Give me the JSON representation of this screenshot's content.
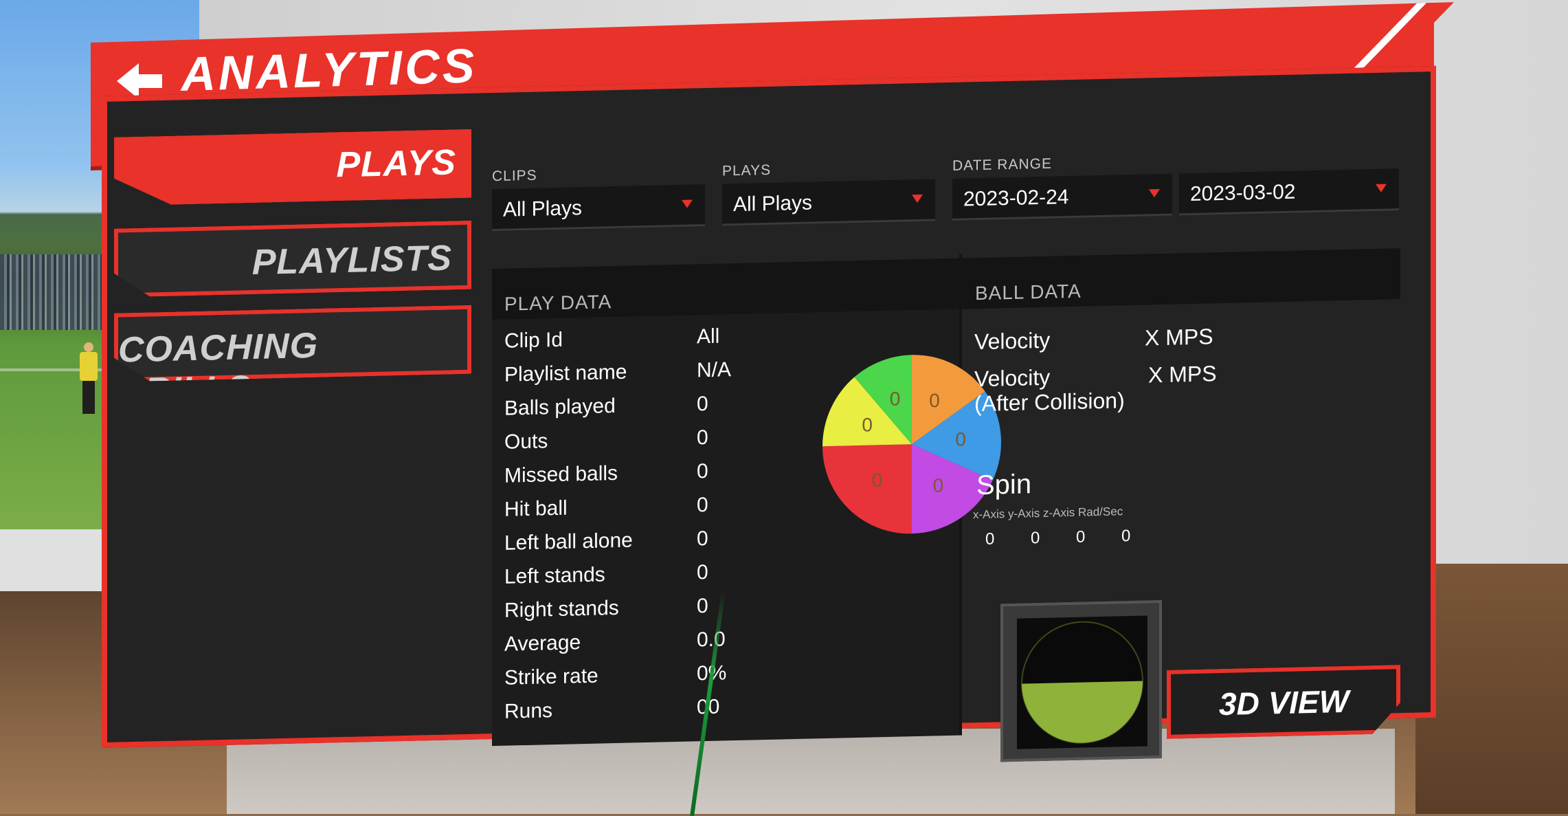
{
  "header": {
    "title": "ANALYTICS",
    "back_icon": "arrow-left-icon"
  },
  "nav": {
    "plays": "PLAYS",
    "playlists": "PLAYLISTS",
    "coaching_drills": "COACHING DRILLS"
  },
  "filters": {
    "clips_label": "CLIPS",
    "clips_value": "All Plays",
    "plays_label": "PLAYS",
    "plays_value": "All Plays",
    "date_range_label": "DATE RANGE",
    "date_from": "2023-02-24",
    "date_to": "2023-03-02"
  },
  "play_data": {
    "title": "PLAY DATA",
    "rows": [
      {
        "label": "Clip Id",
        "value": "All"
      },
      {
        "label": "Playlist name",
        "value": "N/A"
      },
      {
        "label": "Balls played",
        "value": "0"
      },
      {
        "label": "Outs",
        "value": "0"
      },
      {
        "label": "Missed balls",
        "value": "0"
      },
      {
        "label": "Hit ball",
        "value": "0"
      },
      {
        "label": "Left ball alone",
        "value": "0"
      },
      {
        "label": "Left stands",
        "value": "0"
      },
      {
        "label": "Right stands",
        "value": "0"
      },
      {
        "label": "Average",
        "value": "0.0"
      },
      {
        "label": "Strike rate",
        "value": "0%"
      },
      {
        "label": "Runs",
        "value": "00"
      }
    ],
    "pie": {
      "slices": [
        {
          "color": "#f39a3c",
          "label": "0"
        },
        {
          "color": "#3f9be6",
          "label": "0"
        },
        {
          "color": "#c24be6",
          "label": "0"
        },
        {
          "color": "#e8333b",
          "label": "0"
        },
        {
          "color": "#e9ee42",
          "label": "0"
        },
        {
          "color": "#4bd64b",
          "label": "0"
        }
      ]
    }
  },
  "ball_data": {
    "title": "BALL DATA",
    "velocity_label": "Velocity",
    "velocity_value": "X MPS",
    "velocity_after_label": "Velocity",
    "velocity_after_sub": "(After Collision)",
    "velocity_after_value": "X MPS",
    "spin_title": "Spin",
    "spin_axes": "x-Axis y-Axis z-Axis Rad/Sec",
    "spin_values": [
      "0",
      "0",
      "0",
      "0"
    ],
    "view_3d": "3D VIEW"
  },
  "colors": {
    "accent": "#e8322a",
    "panel": "#232323",
    "ball_green": "#8fb23a"
  }
}
